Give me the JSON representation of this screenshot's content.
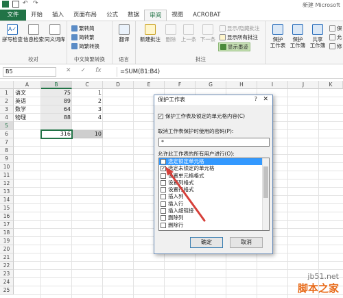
{
  "window": {
    "title": "新建 Microsoft"
  },
  "ribbon_tabs": [
    "文件",
    "开始",
    "插入",
    "页面布局",
    "公式",
    "数据",
    "审阅",
    "视图",
    "ACROBAT"
  ],
  "active_tab": "审阅",
  "groups": {
    "proof": {
      "label": "校对",
      "buttons": [
        "拼写检查",
        "信息检索",
        "同义词库"
      ]
    },
    "chinese": {
      "label": "中文简繁转换",
      "buttons": [
        "繁转简",
        "简转繁",
        "简繁转换"
      ]
    },
    "lang": {
      "label": "语言",
      "buttons": [
        "翻译"
      ]
    },
    "comments": {
      "label": "批注",
      "buttons": [
        "新建批注",
        "删除",
        "上一条",
        "下一条",
        "显示/隐藏批注",
        "显示所有批注",
        "显示墨迹"
      ]
    },
    "changes": {
      "buttons": [
        "保护\n工作表",
        "保护\n工作簿",
        "共享\n工作簿",
        "保",
        "允",
        "修"
      ]
    }
  },
  "formula": {
    "name_box": "B5",
    "cancel": "✕",
    "enter": "✓",
    "fx": "fx",
    "value": "=SUM(B1:B4)"
  },
  "columns": [
    "A",
    "B",
    "C",
    "D",
    "E",
    "F",
    "G",
    "H",
    "I",
    "J",
    "K"
  ],
  "rows": [
    "1",
    "2",
    "3",
    "4",
    "5",
    "6",
    "7",
    "8",
    "9",
    "10",
    "11",
    "12",
    "13",
    "14",
    "15",
    "16",
    "17",
    "18",
    "19",
    "20",
    "21",
    "22",
    "23",
    "24",
    "25"
  ],
  "cells": [
    {
      "a": "语文",
      "b": "75",
      "c": "1"
    },
    {
      "a": "英语",
      "b": "89",
      "c": "2"
    },
    {
      "a": "数学",
      "b": "64",
      "c": "3"
    },
    {
      "a": "物理",
      "b": "88",
      "c": "4"
    },
    {
      "a": "",
      "b": "316",
      "c": "10"
    }
  ],
  "dialog": {
    "title": "保护工作表",
    "help": "?",
    "close": "✕",
    "protect_label": "保护工作表及锁定的单元格内容(C)",
    "password_label": "取消工作表保护时使用的密码(P):",
    "password_value": "*",
    "allow_label": "允许此工作表的所有用户进行(O):",
    "options": [
      {
        "label": "选定锁定单元格",
        "checked": true
      },
      {
        "label": "选定未锁定的单元格",
        "checked": true
      },
      {
        "label": "设置单元格格式",
        "checked": false
      },
      {
        "label": "设置列格式",
        "checked": false
      },
      {
        "label": "设置行格式",
        "checked": false
      },
      {
        "label": "插入列",
        "checked": false
      },
      {
        "label": "插入行",
        "checked": false
      },
      {
        "label": "插入超链接",
        "checked": false
      },
      {
        "label": "删除列",
        "checked": false
      },
      {
        "label": "删除行",
        "checked": false
      }
    ],
    "ok": "确定",
    "cancel": "取消"
  },
  "watermark": {
    "line1": "jb51.net",
    "line2": "脚本之家"
  },
  "colors": {
    "accent": "#217346",
    "selection": "#3399ff",
    "arrow": "#d6403a"
  }
}
